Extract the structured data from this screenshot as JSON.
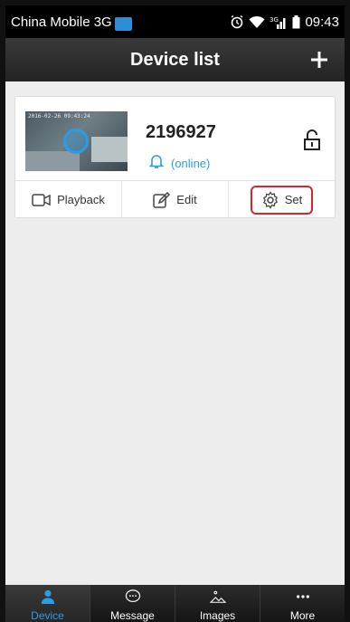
{
  "status_bar": {
    "carrier": "China Mobile 3G",
    "network_type": "3G",
    "time": "09:43"
  },
  "header": {
    "title": "Device list",
    "add_icon": "plus-icon"
  },
  "device": {
    "id": "2196927",
    "status": "(online)",
    "thumbnail_timestamp": "2016-02-26  09:43:24",
    "status_color": "#2b9de8",
    "actions": [
      {
        "label": "Playback",
        "icon": "video-camera-icon"
      },
      {
        "label": "Edit",
        "icon": "edit-icon"
      },
      {
        "label": "Set",
        "icon": "gear-icon",
        "highlighted": true
      }
    ]
  },
  "bottom_nav": {
    "items": [
      {
        "label": "Device",
        "icon": "person-icon",
        "active": true
      },
      {
        "label": "Message",
        "icon": "chat-bubble-icon"
      },
      {
        "label": "Images",
        "icon": "image-icon"
      },
      {
        "label": "More",
        "icon": "more-icon"
      }
    ]
  },
  "colors": {
    "accent": "#2b9de8",
    "highlight_border": "#d9232d"
  }
}
